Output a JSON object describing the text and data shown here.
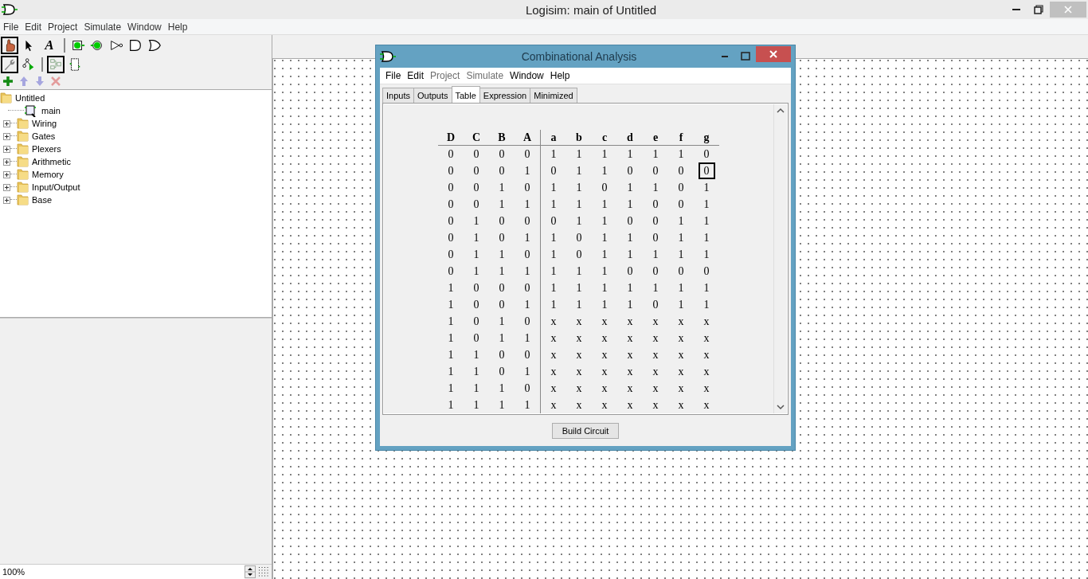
{
  "window": {
    "title": "Logisim: main of Untitled"
  },
  "menu": [
    {
      "label": "File"
    },
    {
      "label": "Edit"
    },
    {
      "label": "Project"
    },
    {
      "label": "Simulate"
    },
    {
      "label": "Window"
    },
    {
      "label": "Help"
    }
  ],
  "toolbar": [
    {
      "kind": "hand",
      "selected": true
    },
    {
      "kind": "arrow",
      "selected": false
    },
    {
      "kind": "text",
      "label": "A",
      "selected": false
    },
    {
      "kind": "sep"
    },
    {
      "kind": "input",
      "selected": false
    },
    {
      "kind": "output",
      "selected": false
    },
    {
      "kind": "not",
      "selected": false
    },
    {
      "kind": "and",
      "selected": false
    },
    {
      "kind": "or",
      "selected": false
    }
  ],
  "view_toolbar": [
    {
      "kind": "wrench",
      "selected": true
    },
    {
      "kind": "tree",
      "selected": false
    },
    {
      "kind": "sep"
    },
    {
      "kind": "layout",
      "selected": true
    },
    {
      "kind": "appearance",
      "selected": false
    }
  ],
  "project_toolbar": [
    {
      "kind": "add",
      "disabled": false
    },
    {
      "kind": "up",
      "disabled": true
    },
    {
      "kind": "down",
      "disabled": true
    },
    {
      "kind": "delete",
      "disabled": true
    }
  ],
  "explorer": {
    "root": "Untitled",
    "children": [
      {
        "kind": "circuit",
        "label": "main"
      },
      {
        "kind": "folder",
        "label": "Wiring",
        "expanded": false
      },
      {
        "kind": "folder",
        "label": "Gates",
        "expanded": false
      },
      {
        "kind": "folder",
        "label": "Plexers",
        "expanded": false
      },
      {
        "kind": "folder",
        "label": "Arithmetic",
        "expanded": false
      },
      {
        "kind": "folder",
        "label": "Memory",
        "expanded": false
      },
      {
        "kind": "folder",
        "label": "Input/Output",
        "expanded": false
      },
      {
        "kind": "folder",
        "label": "Base",
        "expanded": false
      }
    ]
  },
  "zoom": {
    "value": "100%"
  },
  "dialog": {
    "title": "Combinational Analysis",
    "menu": [
      {
        "label": "File",
        "disabled": false
      },
      {
        "label": "Edit",
        "disabled": false
      },
      {
        "label": "Project",
        "disabled": true
      },
      {
        "label": "Simulate",
        "disabled": true
      },
      {
        "label": "Window",
        "disabled": false
      },
      {
        "label": "Help",
        "disabled": false
      }
    ],
    "tabs": [
      {
        "label": "Inputs",
        "selected": false
      },
      {
        "label": "Outputs",
        "selected": false
      },
      {
        "label": "Table",
        "selected": true
      },
      {
        "label": "Expression",
        "selected": false
      },
      {
        "label": "Minimized",
        "selected": false
      }
    ],
    "table": {
      "inputs": [
        {
          "label": "D"
        },
        {
          "label": "C"
        },
        {
          "label": "B"
        },
        {
          "label": "A"
        }
      ],
      "outputs": [
        {
          "label": "a"
        },
        {
          "label": "b"
        },
        {
          "label": "c"
        },
        {
          "label": "d"
        },
        {
          "label": "e"
        },
        {
          "label": "f"
        },
        {
          "label": "g"
        }
      ],
      "rows": [
        {
          "inputs": [
            "0",
            "0",
            "0",
            "0"
          ],
          "outputs": [
            {
              "value": "1",
              "selected": false
            },
            {
              "value": "1",
              "selected": false
            },
            {
              "value": "1",
              "selected": false
            },
            {
              "value": "1",
              "selected": false
            },
            {
              "value": "1",
              "selected": false
            },
            {
              "value": "1",
              "selected": false
            },
            {
              "value": "0",
              "selected": false
            }
          ]
        },
        {
          "inputs": [
            "0",
            "0",
            "0",
            "1"
          ],
          "outputs": [
            {
              "value": "0",
              "selected": false
            },
            {
              "value": "1",
              "selected": false
            },
            {
              "value": "1",
              "selected": false
            },
            {
              "value": "0",
              "selected": false
            },
            {
              "value": "0",
              "selected": false
            },
            {
              "value": "0",
              "selected": false
            },
            {
              "value": "0",
              "selected": true
            }
          ]
        },
        {
          "inputs": [
            "0",
            "0",
            "1",
            "0"
          ],
          "outputs": [
            {
              "value": "1",
              "selected": false
            },
            {
              "value": "1",
              "selected": false
            },
            {
              "value": "0",
              "selected": false
            },
            {
              "value": "1",
              "selected": false
            },
            {
              "value": "1",
              "selected": false
            },
            {
              "value": "0",
              "selected": false
            },
            {
              "value": "1",
              "selected": false
            }
          ]
        },
        {
          "inputs": [
            "0",
            "0",
            "1",
            "1"
          ],
          "outputs": [
            {
              "value": "1",
              "selected": false
            },
            {
              "value": "1",
              "selected": false
            },
            {
              "value": "1",
              "selected": false
            },
            {
              "value": "1",
              "selected": false
            },
            {
              "value": "0",
              "selected": false
            },
            {
              "value": "0",
              "selected": false
            },
            {
              "value": "1",
              "selected": false
            }
          ]
        },
        {
          "inputs": [
            "0",
            "1",
            "0",
            "0"
          ],
          "outputs": [
            {
              "value": "0",
              "selected": false
            },
            {
              "value": "1",
              "selected": false
            },
            {
              "value": "1",
              "selected": false
            },
            {
              "value": "0",
              "selected": false
            },
            {
              "value": "0",
              "selected": false
            },
            {
              "value": "1",
              "selected": false
            },
            {
              "value": "1",
              "selected": false
            }
          ]
        },
        {
          "inputs": [
            "0",
            "1",
            "0",
            "1"
          ],
          "outputs": [
            {
              "value": "1",
              "selected": false
            },
            {
              "value": "0",
              "selected": false
            },
            {
              "value": "1",
              "selected": false
            },
            {
              "value": "1",
              "selected": false
            },
            {
              "value": "0",
              "selected": false
            },
            {
              "value": "1",
              "selected": false
            },
            {
              "value": "1",
              "selected": false
            }
          ]
        },
        {
          "inputs": [
            "0",
            "1",
            "1",
            "0"
          ],
          "outputs": [
            {
              "value": "1",
              "selected": false
            },
            {
              "value": "0",
              "selected": false
            },
            {
              "value": "1",
              "selected": false
            },
            {
              "value": "1",
              "selected": false
            },
            {
              "value": "1",
              "selected": false
            },
            {
              "value": "1",
              "selected": false
            },
            {
              "value": "1",
              "selected": false
            }
          ]
        },
        {
          "inputs": [
            "0",
            "1",
            "1",
            "1"
          ],
          "outputs": [
            {
              "value": "1",
              "selected": false
            },
            {
              "value": "1",
              "selected": false
            },
            {
              "value": "1",
              "selected": false
            },
            {
              "value": "0",
              "selected": false
            },
            {
              "value": "0",
              "selected": false
            },
            {
              "value": "0",
              "selected": false
            },
            {
              "value": "0",
              "selected": false
            }
          ]
        },
        {
          "inputs": [
            "1",
            "0",
            "0",
            "0"
          ],
          "outputs": [
            {
              "value": "1",
              "selected": false
            },
            {
              "value": "1",
              "selected": false
            },
            {
              "value": "1",
              "selected": false
            },
            {
              "value": "1",
              "selected": false
            },
            {
              "value": "1",
              "selected": false
            },
            {
              "value": "1",
              "selected": false
            },
            {
              "value": "1",
              "selected": false
            }
          ]
        },
        {
          "inputs": [
            "1",
            "0",
            "0",
            "1"
          ],
          "outputs": [
            {
              "value": "1",
              "selected": false
            },
            {
              "value": "1",
              "selected": false
            },
            {
              "value": "1",
              "selected": false
            },
            {
              "value": "1",
              "selected": false
            },
            {
              "value": "0",
              "selected": false
            },
            {
              "value": "1",
              "selected": false
            },
            {
              "value": "1",
              "selected": false
            }
          ]
        },
        {
          "inputs": [
            "1",
            "0",
            "1",
            "0"
          ],
          "outputs": [
            {
              "value": "x",
              "selected": false
            },
            {
              "value": "x",
              "selected": false
            },
            {
              "value": "x",
              "selected": false
            },
            {
              "value": "x",
              "selected": false
            },
            {
              "value": "x",
              "selected": false
            },
            {
              "value": "x",
              "selected": false
            },
            {
              "value": "x",
              "selected": false
            }
          ]
        },
        {
          "inputs": [
            "1",
            "0",
            "1",
            "1"
          ],
          "outputs": [
            {
              "value": "x",
              "selected": false
            },
            {
              "value": "x",
              "selected": false
            },
            {
              "value": "x",
              "selected": false
            },
            {
              "value": "x",
              "selected": false
            },
            {
              "value": "x",
              "selected": false
            },
            {
              "value": "x",
              "selected": false
            },
            {
              "value": "x",
              "selected": false
            }
          ]
        },
        {
          "inputs": [
            "1",
            "1",
            "0",
            "0"
          ],
          "outputs": [
            {
              "value": "x",
              "selected": false
            },
            {
              "value": "x",
              "selected": false
            },
            {
              "value": "x",
              "selected": false
            },
            {
              "value": "x",
              "selected": false
            },
            {
              "value": "x",
              "selected": false
            },
            {
              "value": "x",
              "selected": false
            },
            {
              "value": "x",
              "selected": false
            }
          ]
        },
        {
          "inputs": [
            "1",
            "1",
            "0",
            "1"
          ],
          "outputs": [
            {
              "value": "x",
              "selected": false
            },
            {
              "value": "x",
              "selected": false
            },
            {
              "value": "x",
              "selected": false
            },
            {
              "value": "x",
              "selected": false
            },
            {
              "value": "x",
              "selected": false
            },
            {
              "value": "x",
              "selected": false
            },
            {
              "value": "x",
              "selected": false
            }
          ]
        },
        {
          "inputs": [
            "1",
            "1",
            "1",
            "0"
          ],
          "outputs": [
            {
              "value": "x",
              "selected": false
            },
            {
              "value": "x",
              "selected": false
            },
            {
              "value": "x",
              "selected": false
            },
            {
              "value": "x",
              "selected": false
            },
            {
              "value": "x",
              "selected": false
            },
            {
              "value": "x",
              "selected": false
            },
            {
              "value": "x",
              "selected": false
            }
          ]
        },
        {
          "inputs": [
            "1",
            "1",
            "1",
            "1"
          ],
          "outputs": [
            {
              "value": "x",
              "selected": false
            },
            {
              "value": "x",
              "selected": false
            },
            {
              "value": "x",
              "selected": false
            },
            {
              "value": "x",
              "selected": false
            },
            {
              "value": "x",
              "selected": false
            },
            {
              "value": "x",
              "selected": false
            },
            {
              "value": "x",
              "selected": false
            }
          ]
        }
      ]
    },
    "button": "Build Circuit"
  }
}
